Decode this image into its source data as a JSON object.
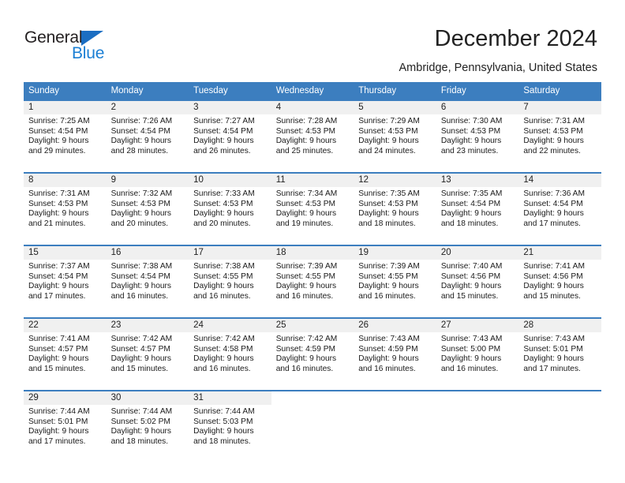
{
  "brand": {
    "name_top": "General",
    "name_bottom": "Blue",
    "accent_color": "#1b7fd4",
    "header_color": "#3c7ebf"
  },
  "header": {
    "title": "December 2024",
    "subtitle": "Ambridge, Pennsylvania, United States"
  },
  "weekdays": [
    "Sunday",
    "Monday",
    "Tuesday",
    "Wednesday",
    "Thursday",
    "Friday",
    "Saturday"
  ],
  "labels": {
    "sunrise_prefix": "Sunrise: ",
    "sunset_prefix": "Sunset: ",
    "daylight_prefix": "Daylight: "
  },
  "weeks": [
    [
      {
        "day": "1",
        "sunrise": "Sunrise: 7:25 AM",
        "sunset": "Sunset: 4:54 PM",
        "daylight_1": "Daylight: 9 hours",
        "daylight_2": "and 29 minutes."
      },
      {
        "day": "2",
        "sunrise": "Sunrise: 7:26 AM",
        "sunset": "Sunset: 4:54 PM",
        "daylight_1": "Daylight: 9 hours",
        "daylight_2": "and 28 minutes."
      },
      {
        "day": "3",
        "sunrise": "Sunrise: 7:27 AM",
        "sunset": "Sunset: 4:54 PM",
        "daylight_1": "Daylight: 9 hours",
        "daylight_2": "and 26 minutes."
      },
      {
        "day": "4",
        "sunrise": "Sunrise: 7:28 AM",
        "sunset": "Sunset: 4:53 PM",
        "daylight_1": "Daylight: 9 hours",
        "daylight_2": "and 25 minutes."
      },
      {
        "day": "5",
        "sunrise": "Sunrise: 7:29 AM",
        "sunset": "Sunset: 4:53 PM",
        "daylight_1": "Daylight: 9 hours",
        "daylight_2": "and 24 minutes."
      },
      {
        "day": "6",
        "sunrise": "Sunrise: 7:30 AM",
        "sunset": "Sunset: 4:53 PM",
        "daylight_1": "Daylight: 9 hours",
        "daylight_2": "and 23 minutes."
      },
      {
        "day": "7",
        "sunrise": "Sunrise: 7:31 AM",
        "sunset": "Sunset: 4:53 PM",
        "daylight_1": "Daylight: 9 hours",
        "daylight_2": "and 22 minutes."
      }
    ],
    [
      {
        "day": "8",
        "sunrise": "Sunrise: 7:31 AM",
        "sunset": "Sunset: 4:53 PM",
        "daylight_1": "Daylight: 9 hours",
        "daylight_2": "and 21 minutes."
      },
      {
        "day": "9",
        "sunrise": "Sunrise: 7:32 AM",
        "sunset": "Sunset: 4:53 PM",
        "daylight_1": "Daylight: 9 hours",
        "daylight_2": "and 20 minutes."
      },
      {
        "day": "10",
        "sunrise": "Sunrise: 7:33 AM",
        "sunset": "Sunset: 4:53 PM",
        "daylight_1": "Daylight: 9 hours",
        "daylight_2": "and 20 minutes."
      },
      {
        "day": "11",
        "sunrise": "Sunrise: 7:34 AM",
        "sunset": "Sunset: 4:53 PM",
        "daylight_1": "Daylight: 9 hours",
        "daylight_2": "and 19 minutes."
      },
      {
        "day": "12",
        "sunrise": "Sunrise: 7:35 AM",
        "sunset": "Sunset: 4:53 PM",
        "daylight_1": "Daylight: 9 hours",
        "daylight_2": "and 18 minutes."
      },
      {
        "day": "13",
        "sunrise": "Sunrise: 7:35 AM",
        "sunset": "Sunset: 4:54 PM",
        "daylight_1": "Daylight: 9 hours",
        "daylight_2": "and 18 minutes."
      },
      {
        "day": "14",
        "sunrise": "Sunrise: 7:36 AM",
        "sunset": "Sunset: 4:54 PM",
        "daylight_1": "Daylight: 9 hours",
        "daylight_2": "and 17 minutes."
      }
    ],
    [
      {
        "day": "15",
        "sunrise": "Sunrise: 7:37 AM",
        "sunset": "Sunset: 4:54 PM",
        "daylight_1": "Daylight: 9 hours",
        "daylight_2": "and 17 minutes."
      },
      {
        "day": "16",
        "sunrise": "Sunrise: 7:38 AM",
        "sunset": "Sunset: 4:54 PM",
        "daylight_1": "Daylight: 9 hours",
        "daylight_2": "and 16 minutes."
      },
      {
        "day": "17",
        "sunrise": "Sunrise: 7:38 AM",
        "sunset": "Sunset: 4:55 PM",
        "daylight_1": "Daylight: 9 hours",
        "daylight_2": "and 16 minutes."
      },
      {
        "day": "18",
        "sunrise": "Sunrise: 7:39 AM",
        "sunset": "Sunset: 4:55 PM",
        "daylight_1": "Daylight: 9 hours",
        "daylight_2": "and 16 minutes."
      },
      {
        "day": "19",
        "sunrise": "Sunrise: 7:39 AM",
        "sunset": "Sunset: 4:55 PM",
        "daylight_1": "Daylight: 9 hours",
        "daylight_2": "and 16 minutes."
      },
      {
        "day": "20",
        "sunrise": "Sunrise: 7:40 AM",
        "sunset": "Sunset: 4:56 PM",
        "daylight_1": "Daylight: 9 hours",
        "daylight_2": "and 15 minutes."
      },
      {
        "day": "21",
        "sunrise": "Sunrise: 7:41 AM",
        "sunset": "Sunset: 4:56 PM",
        "daylight_1": "Daylight: 9 hours",
        "daylight_2": "and 15 minutes."
      }
    ],
    [
      {
        "day": "22",
        "sunrise": "Sunrise: 7:41 AM",
        "sunset": "Sunset: 4:57 PM",
        "daylight_1": "Daylight: 9 hours",
        "daylight_2": "and 15 minutes."
      },
      {
        "day": "23",
        "sunrise": "Sunrise: 7:42 AM",
        "sunset": "Sunset: 4:57 PM",
        "daylight_1": "Daylight: 9 hours",
        "daylight_2": "and 15 minutes."
      },
      {
        "day": "24",
        "sunrise": "Sunrise: 7:42 AM",
        "sunset": "Sunset: 4:58 PM",
        "daylight_1": "Daylight: 9 hours",
        "daylight_2": "and 16 minutes."
      },
      {
        "day": "25",
        "sunrise": "Sunrise: 7:42 AM",
        "sunset": "Sunset: 4:59 PM",
        "daylight_1": "Daylight: 9 hours",
        "daylight_2": "and 16 minutes."
      },
      {
        "day": "26",
        "sunrise": "Sunrise: 7:43 AM",
        "sunset": "Sunset: 4:59 PM",
        "daylight_1": "Daylight: 9 hours",
        "daylight_2": "and 16 minutes."
      },
      {
        "day": "27",
        "sunrise": "Sunrise: 7:43 AM",
        "sunset": "Sunset: 5:00 PM",
        "daylight_1": "Daylight: 9 hours",
        "daylight_2": "and 16 minutes."
      },
      {
        "day": "28",
        "sunrise": "Sunrise: 7:43 AM",
        "sunset": "Sunset: 5:01 PM",
        "daylight_1": "Daylight: 9 hours",
        "daylight_2": "and 17 minutes."
      }
    ],
    [
      {
        "day": "29",
        "sunrise": "Sunrise: 7:44 AM",
        "sunset": "Sunset: 5:01 PM",
        "daylight_1": "Daylight: 9 hours",
        "daylight_2": "and 17 minutes."
      },
      {
        "day": "30",
        "sunrise": "Sunrise: 7:44 AM",
        "sunset": "Sunset: 5:02 PM",
        "daylight_1": "Daylight: 9 hours",
        "daylight_2": "and 18 minutes."
      },
      {
        "day": "31",
        "sunrise": "Sunrise: 7:44 AM",
        "sunset": "Sunset: 5:03 PM",
        "daylight_1": "Daylight: 9 hours",
        "daylight_2": "and 18 minutes."
      },
      {
        "day": "",
        "sunrise": "",
        "sunset": "",
        "daylight_1": "",
        "daylight_2": ""
      },
      {
        "day": "",
        "sunrise": "",
        "sunset": "",
        "daylight_1": "",
        "daylight_2": ""
      },
      {
        "day": "",
        "sunrise": "",
        "sunset": "",
        "daylight_1": "",
        "daylight_2": ""
      },
      {
        "day": "",
        "sunrise": "",
        "sunset": "",
        "daylight_1": "",
        "daylight_2": ""
      }
    ]
  ]
}
